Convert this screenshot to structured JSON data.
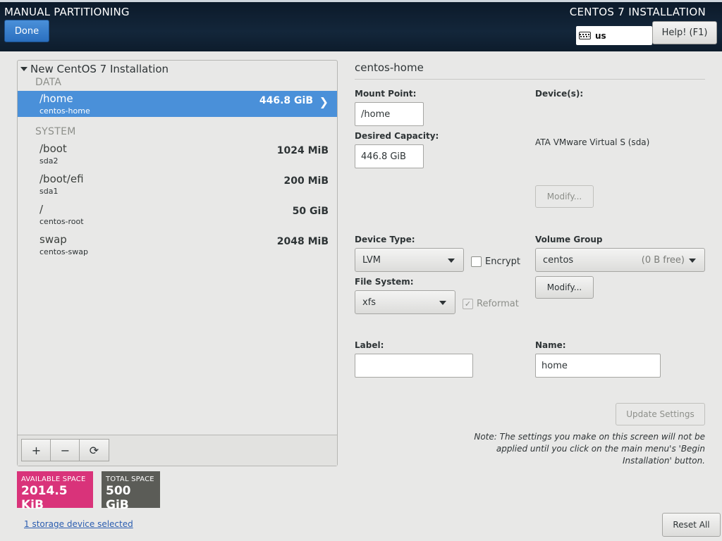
{
  "header": {
    "title": "MANUAL PARTITIONING",
    "done_label": "Done",
    "product_title": "CENTOS 7 INSTALLATION",
    "keyboard_layout": "us",
    "help_label": "Help! (F1)"
  },
  "tree": {
    "root_label": "New CentOS 7 Installation",
    "data_section": "DATA",
    "system_section": "SYSTEM",
    "data_items": [
      {
        "mount": "/home",
        "device": "centos-home",
        "size": "446.8 GiB",
        "selected": true
      }
    ],
    "system_items": [
      {
        "mount": "/boot",
        "device": "sda2",
        "size": "1024 MiB"
      },
      {
        "mount": "/boot/efi",
        "device": "sda1",
        "size": "200 MiB"
      },
      {
        "mount": "/",
        "device": "centos-root",
        "size": "50 GiB"
      },
      {
        "mount": "swap",
        "device": "centos-swap",
        "size": "2048 MiB"
      }
    ],
    "toolbar": {
      "add": "+",
      "remove": "−",
      "refresh": "⟳"
    }
  },
  "space": {
    "available_label": "AVAILABLE SPACE",
    "available_value": "2014.5 KiB",
    "available_color": "#d9337a",
    "total_label": "TOTAL SPACE",
    "total_value": "500 GiB",
    "total_color": "#5b5c57"
  },
  "storage_link": "1 storage device selected",
  "detail": {
    "section_title": "centos-home",
    "mount_point_label": "Mount Point:",
    "mount_point_value": "/home",
    "desired_capacity_label": "Desired Capacity:",
    "desired_capacity_value": "446.8 GiB",
    "devices_label": "Device(s):",
    "device_name": "ATA VMware Virtual S (sda)",
    "modify_devices_label": "Modify...",
    "device_type_label": "Device Type:",
    "device_type_value": "LVM",
    "encrypt_label": "Encrypt",
    "volume_group_label": "Volume Group",
    "volume_group_value": "centos",
    "volume_group_free": "(0 B free)",
    "modify_vg_label": "Modify...",
    "file_system_label": "File System:",
    "file_system_value": "xfs",
    "reformat_label": "Reformat",
    "label_label": "Label:",
    "label_value": "",
    "name_label": "Name:",
    "name_value": "home",
    "update_settings_label": "Update Settings",
    "note": "Note:  The settings you make on this screen will not be applied until you click on the main menu's 'Begin Installation' button.",
    "reset_all_label": "Reset All"
  }
}
